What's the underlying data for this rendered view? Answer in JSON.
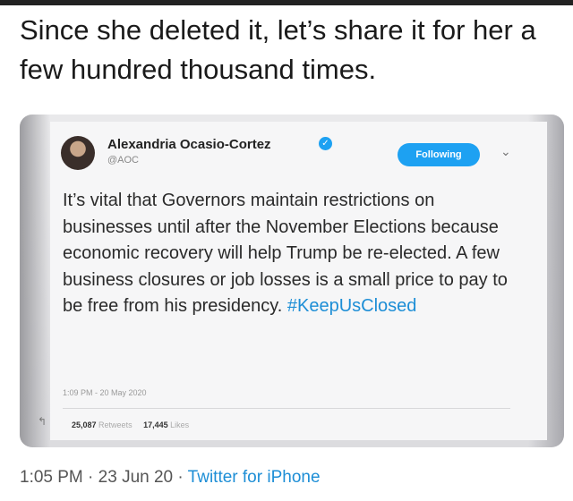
{
  "post": {
    "text": "Since she deleted it, let’s share it for her a few hundred thousand times.",
    "time": "1:05 PM",
    "date": "23 Jun 20",
    "source": "Twitter for iPhone",
    "sep": " · "
  },
  "tweet": {
    "author": "Alexandria Ocasio-Cortez",
    "handle": "@AOC",
    "follow_label": "Following",
    "body": "It’s vital that Governors maintain restrictions on businesses until after the November Elections because economic recovery will help Trump be re-elected. A few business closures or job losses is a small price to pay to be free from his presidency. ",
    "hashtag": "#KeepUsClosed",
    "timestamp": "1:09 PM - 20 May 2020",
    "retweets": "25,087",
    "retweets_label": "Retweets",
    "likes": "17,445",
    "likes_label": "Likes",
    "verified_icon": "check",
    "chevron_icon": "⌄",
    "reply_icon": "↰"
  },
  "colors": {
    "accent": "#1da1f2",
    "hashtag": "#1d8ed6"
  }
}
